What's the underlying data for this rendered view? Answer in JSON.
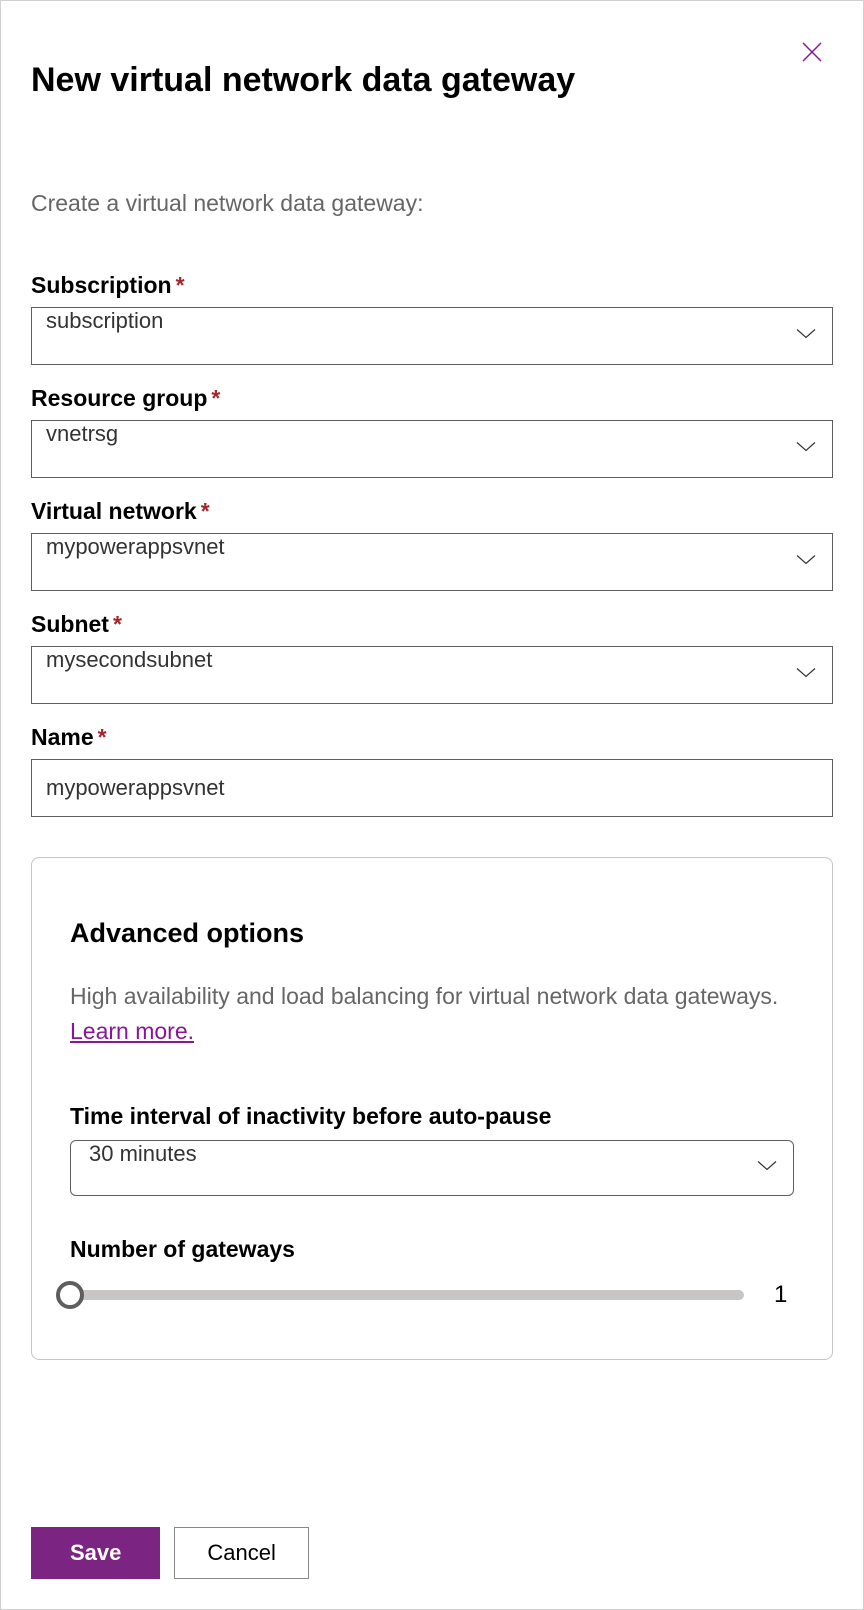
{
  "dialog": {
    "title": "New virtual network data gateway",
    "subtitle": "Create a virtual network data gateway:"
  },
  "fields": {
    "subscription": {
      "label": "Subscription",
      "value": "subscription",
      "required": true
    },
    "resource_group": {
      "label": "Resource group",
      "value": "vnetrsg",
      "required": true
    },
    "virtual_network": {
      "label": "Virtual network",
      "value": "mypowerappsvnet",
      "required": true
    },
    "subnet": {
      "label": "Subnet",
      "value": "mysecondsubnet",
      "required": true
    },
    "name": {
      "label": "Name",
      "value": "mypowerappsvnet",
      "required": true
    }
  },
  "advanced": {
    "title": "Advanced options",
    "description": "High availability and load balancing for virtual network data gateways. ",
    "learn_more_label": "Learn more.",
    "time_interval": {
      "label": "Time interval of inactivity before auto-pause",
      "value": "30 minutes"
    },
    "num_gateways": {
      "label": "Number of gateways",
      "value": "1"
    }
  },
  "buttons": {
    "save": "Save",
    "cancel": "Cancel"
  },
  "required_marker": "*"
}
